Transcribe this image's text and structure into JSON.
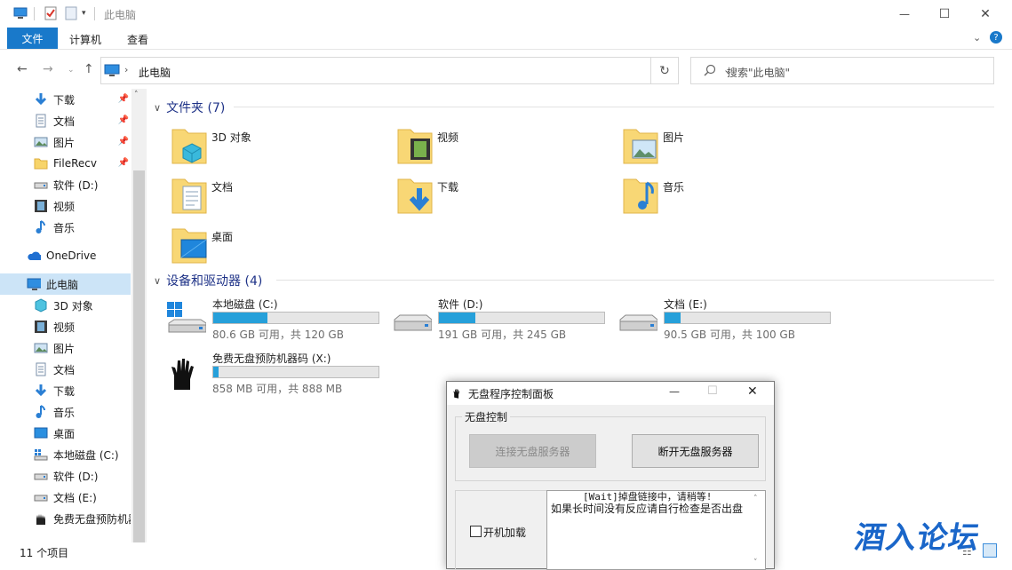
{
  "window": {
    "title": "此电脑",
    "controls": {
      "minimize": "—",
      "maximize": "☐",
      "close": "✕"
    }
  },
  "ribbon": {
    "tabs": [
      "文件",
      "计算机",
      "查看"
    ],
    "expand_icon": "chevron-down-icon",
    "help_icon": "help-icon"
  },
  "nav": {
    "address": "此电脑",
    "search_placeholder": "搜索\"此电脑\""
  },
  "sidebar": {
    "quick_access": [
      {
        "label": "下载",
        "icon": "download-icon",
        "pinned": true
      },
      {
        "label": "文档",
        "icon": "document-icon",
        "pinned": true
      },
      {
        "label": "图片",
        "icon": "picture-icon",
        "pinned": true
      },
      {
        "label": "FileRecv",
        "icon": "folder-icon",
        "pinned": true
      },
      {
        "label": "软件 (D:)",
        "icon": "drive-icon",
        "pinned": false
      },
      {
        "label": "视频",
        "icon": "video-icon",
        "pinned": false
      },
      {
        "label": "音乐",
        "icon": "music-icon",
        "pinned": false
      }
    ],
    "onedrive": "OneDrive",
    "this_pc": "此电脑",
    "this_pc_children": [
      {
        "label": "3D 对象",
        "icon": "3d-objects-icon"
      },
      {
        "label": "视频",
        "icon": "video-icon"
      },
      {
        "label": "图片",
        "icon": "picture-icon"
      },
      {
        "label": "文档",
        "icon": "document-icon"
      },
      {
        "label": "下载",
        "icon": "download-icon"
      },
      {
        "label": "音乐",
        "icon": "music-icon"
      },
      {
        "label": "桌面",
        "icon": "desktop-icon"
      },
      {
        "label": "本地磁盘 (C:)",
        "icon": "windows-drive-icon"
      },
      {
        "label": "软件 (D:)",
        "icon": "drive-icon"
      },
      {
        "label": "文档 (E:)",
        "icon": "drive-icon"
      },
      {
        "label": "免费无盘预防机器",
        "icon": "hands-icon"
      }
    ]
  },
  "content": {
    "folders_header": "文件夹 (7)",
    "folders": [
      {
        "label": "3D 对象",
        "icon": "3d-objects-folder-icon"
      },
      {
        "label": "视频",
        "icon": "video-folder-icon"
      },
      {
        "label": "图片",
        "icon": "picture-folder-icon"
      },
      {
        "label": "文档",
        "icon": "document-folder-icon"
      },
      {
        "label": "下载",
        "icon": "download-folder-icon"
      },
      {
        "label": "音乐",
        "icon": "music-folder-icon"
      },
      {
        "label": "桌面",
        "icon": "desktop-folder-icon"
      }
    ],
    "drives_header": "设备和驱动器 (4)",
    "drives": [
      {
        "name": "本地磁盘 (C:)",
        "free": "80.6 GB 可用，共 120 GB",
        "used_fraction": 0.33,
        "icon": "windows-drive-icon"
      },
      {
        "name": "软件 (D:)",
        "free": "191 GB 可用，共 245 GB",
        "used_fraction": 0.22,
        "icon": "drive-icon"
      },
      {
        "name": "文档 (E:)",
        "free": "90.5 GB 可用，共 100 GB",
        "used_fraction": 0.095,
        "icon": "drive-icon"
      },
      {
        "name": "免费无盘预防机器码 (X:)",
        "free": "858 MB 可用，共 888 MB",
        "used_fraction": 0.034,
        "icon": "hands-icon"
      }
    ]
  },
  "status": {
    "count": "11 个项目"
  },
  "dialog": {
    "title": "无盘程序控制面板",
    "group_label": "无盘控制",
    "connect_button": "连接无盘服务器",
    "disconnect_button": "断开无盘服务器",
    "autostart_label": "开机加载",
    "log_lines": [
      "[Wait]掉盘链接中，请稍等!",
      "如果长时间没有反应请自行检查是否出盘"
    ]
  },
  "watermark": "酒入论坛",
  "colors": {
    "accent": "#1979ca",
    "drive_fill": "#26a0da",
    "header_text": "#1e3287"
  }
}
